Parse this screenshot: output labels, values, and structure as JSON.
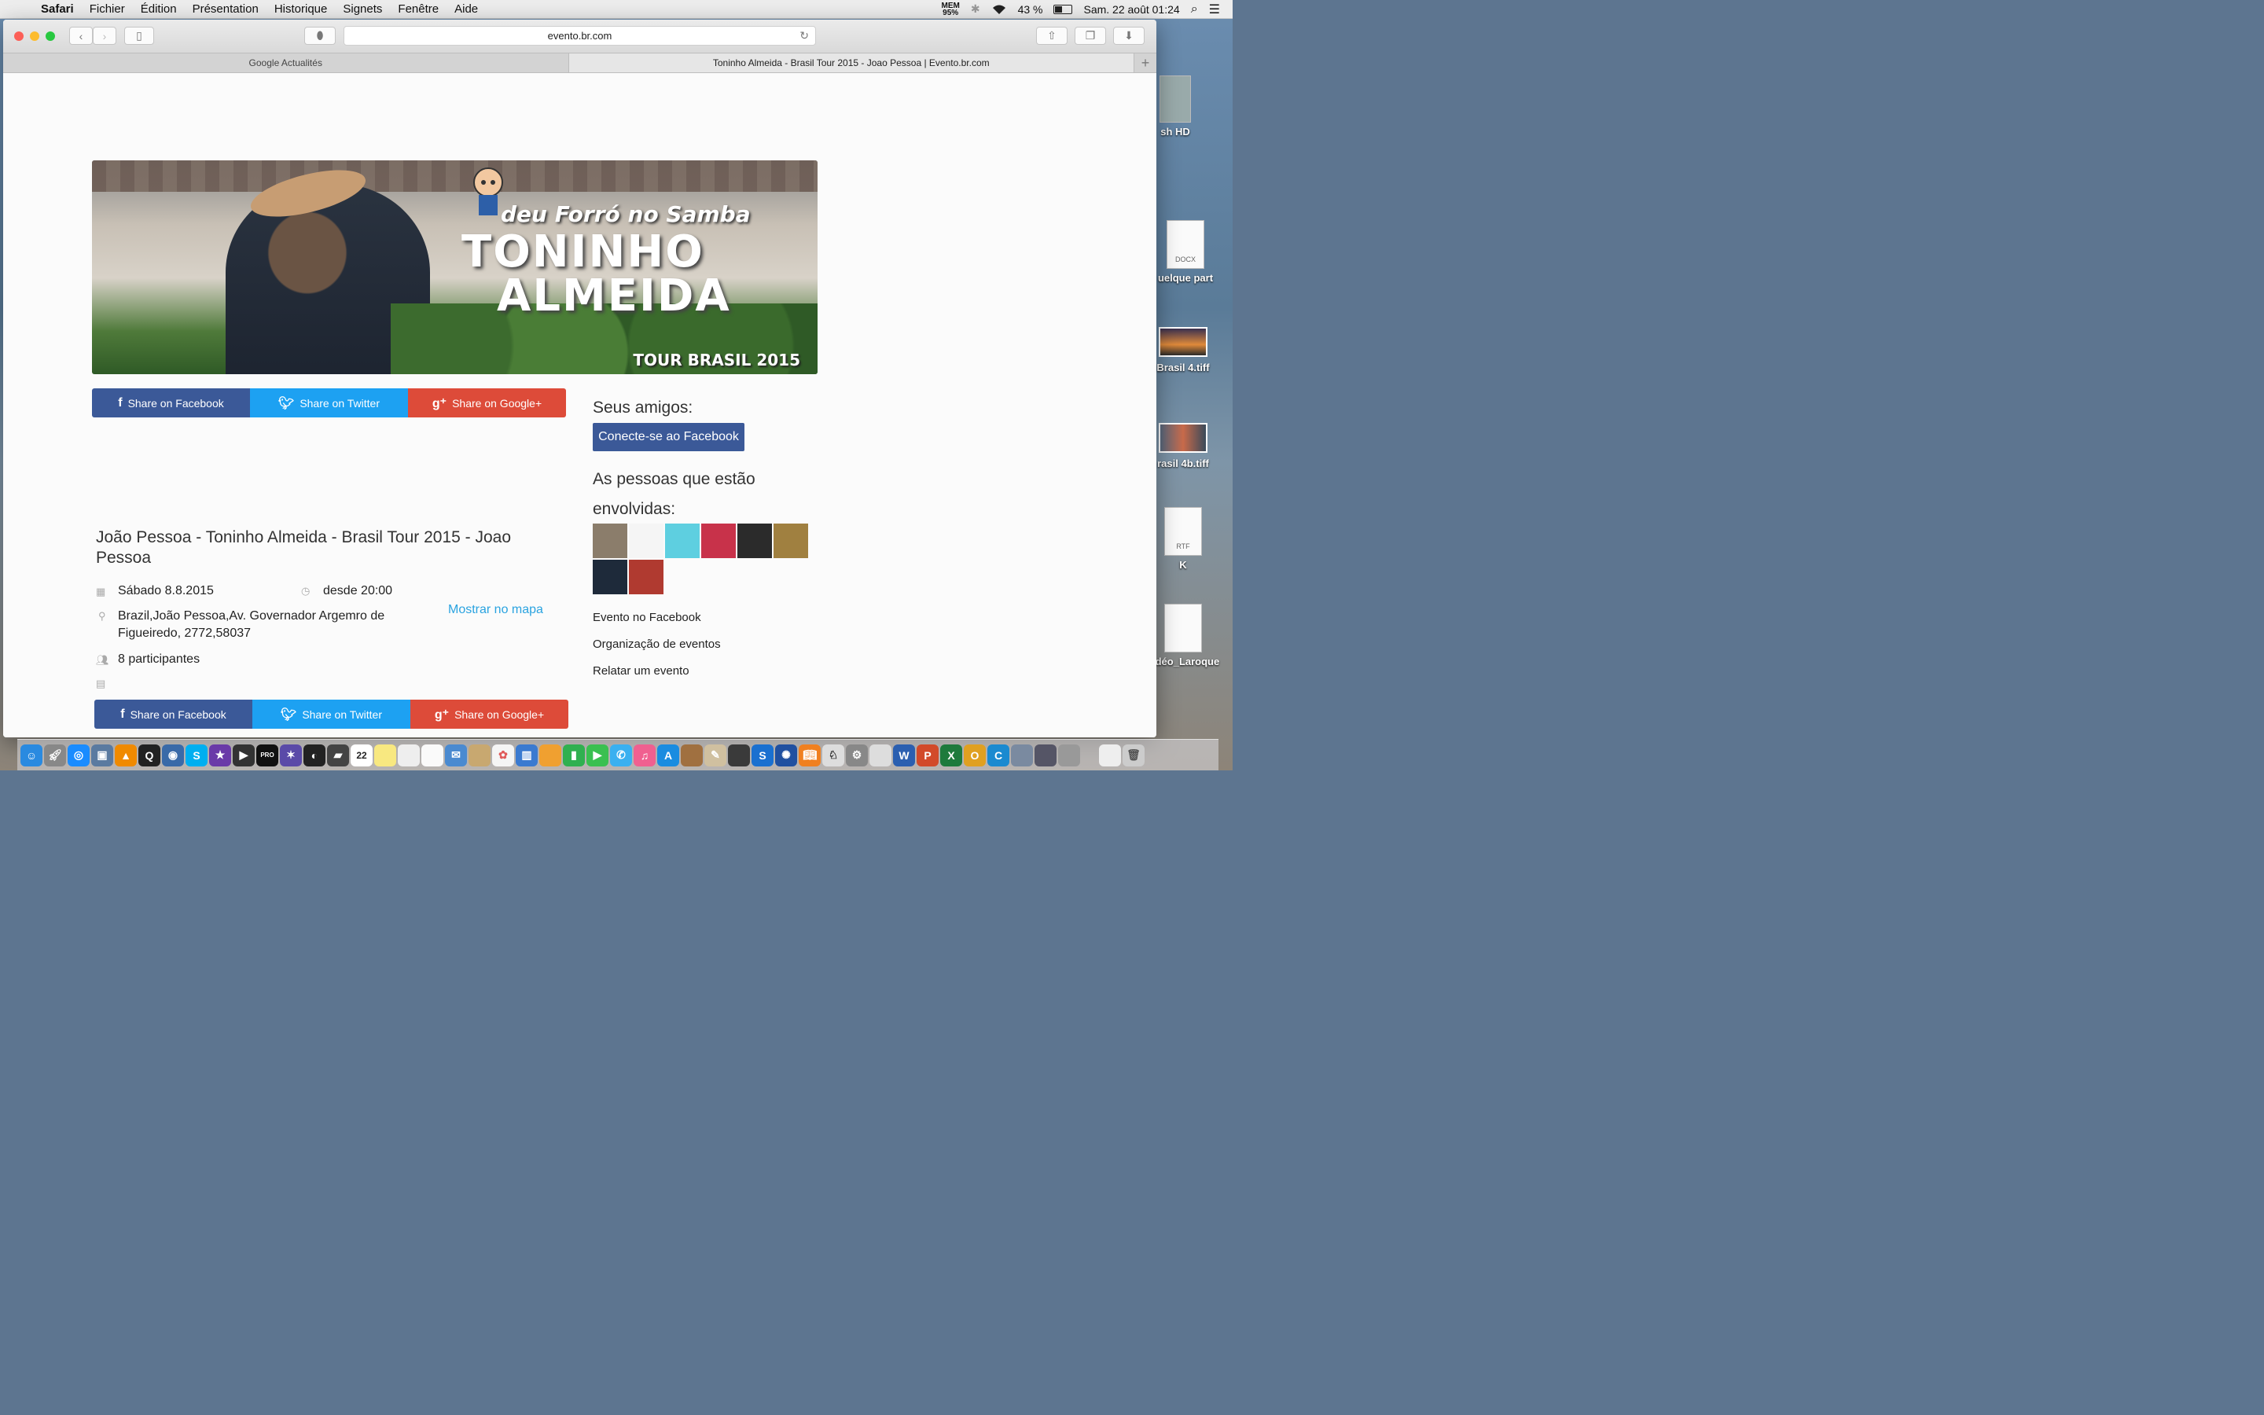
{
  "menubar": {
    "app": "Safari",
    "items": [
      "Fichier",
      "Édition",
      "Présentation",
      "Historique",
      "Signets",
      "Fenêtre",
      "Aide"
    ],
    "mem_label": "MEM",
    "mem_value": "95%",
    "battery": "43 %",
    "clock": "Sam. 22 août 01:24"
  },
  "browser": {
    "url": "evento.br.com",
    "tabs": [
      {
        "label": "Google Actualités"
      },
      {
        "label": "Toninho Almeida - Brasil Tour 2015 - Joao Pessoa | Evento.br.com"
      }
    ],
    "new_tab": "+"
  },
  "banner": {
    "line1": "deu Forró no Samba",
    "line2": "TONINHO",
    "line3": "ALMEIDA",
    "line4": "TOUR BRASIL 2015"
  },
  "share": {
    "facebook": "Share on Facebook",
    "twitter": "Share on Twitter",
    "google": "Share on Google+"
  },
  "event": {
    "title": "João Pessoa - Toninho Almeida - Brasil Tour 2015 - Joao Pessoa",
    "date": "Sábado 8.8.2015",
    "time": "desde 20:00",
    "address": "Brazil,João Pessoa,Av. Governador Argemro de Figueiredo, 2772,58037",
    "map_link": "Mostrar no mapa",
    "participants": "8 participantes"
  },
  "sidebar": {
    "friends_title": "Seus amigos:",
    "connect_button": "Conecte-se ao Facebook",
    "people_title": "As pessoas que estão envolvidas:",
    "avatar_colors": [
      "#8b7d6b",
      "#f5f5f5",
      "#5ecfe0",
      "#c8324a",
      "#2b2b2b",
      "#a08040",
      "#1e2a3a",
      "#b03a30"
    ],
    "links": [
      "Evento no Facebook",
      "Organização de eventos",
      "Relatar um evento"
    ]
  },
  "desktop": {
    "icons": [
      {
        "label": "sh HD"
      },
      {
        "label": "uelque part",
        "badge": "DOCX"
      },
      {
        "label": "Brasil 4.tiff"
      },
      {
        "label": "rasil 4b.tiff"
      },
      {
        "label": "K",
        "badge": "RTF"
      },
      {
        "label": "vidéo_Laroque"
      }
    ]
  },
  "dock": {
    "calendar_day": "22"
  }
}
